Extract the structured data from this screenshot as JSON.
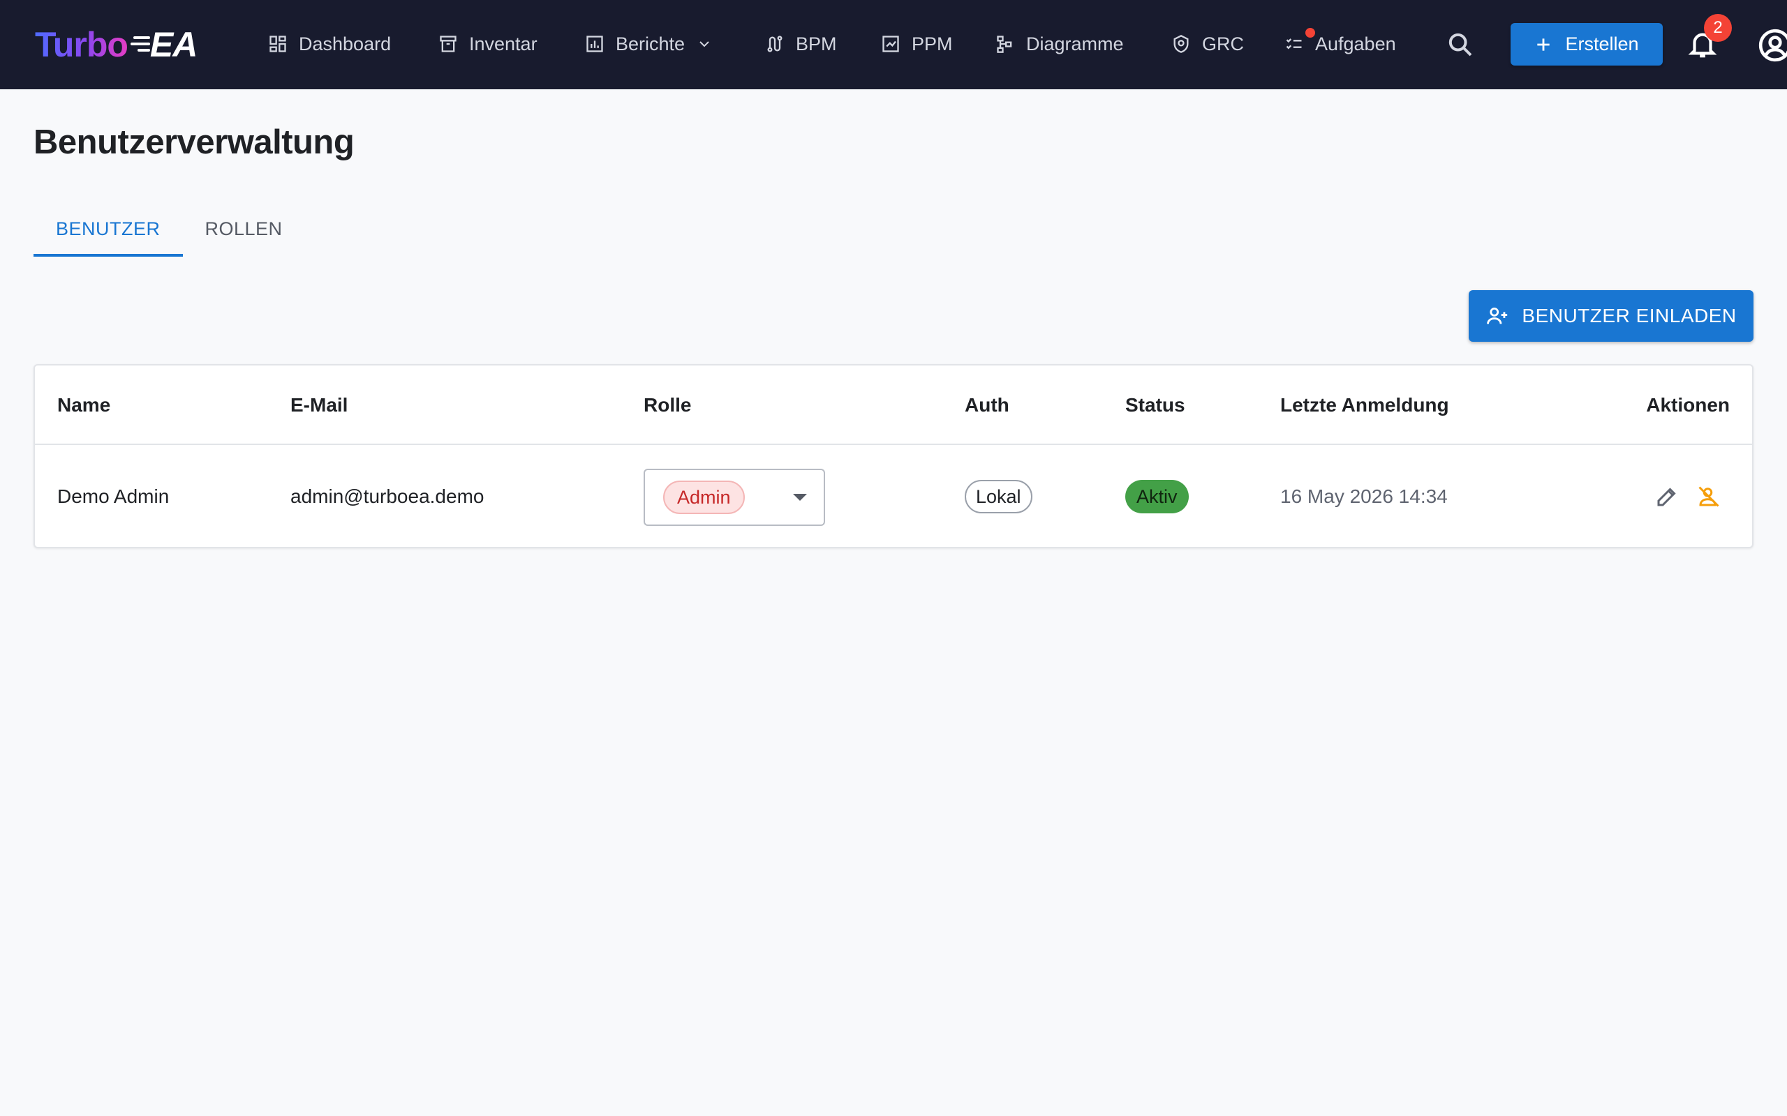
{
  "app": {
    "logo_part1": "Turbo",
    "logo_part2": "EA"
  },
  "nav": {
    "items": [
      {
        "label": "Dashboard",
        "icon": "dashboard-icon"
      },
      {
        "label": "Inventar",
        "icon": "archive-icon"
      },
      {
        "label": "Berichte",
        "icon": "bar-chart-icon"
      },
      {
        "label": "BPM",
        "icon": "route-icon"
      },
      {
        "label": "PPM",
        "icon": "project-icon"
      },
      {
        "label": "Diagramme",
        "icon": "diagram-icon"
      },
      {
        "label": "GRC",
        "icon": "shield-icon"
      },
      {
        "label": "Aufgaben",
        "icon": "checklist-icon"
      }
    ],
    "create_label": "Erstellen",
    "notification_count": "2"
  },
  "page": {
    "title": "Benutzerverwaltung",
    "tabs": [
      {
        "label": "BENUTZER",
        "active": true
      },
      {
        "label": "ROLLEN",
        "active": false
      }
    ],
    "invite_label": "BENUTZER EINLADEN"
  },
  "table": {
    "headers": {
      "name": "Name",
      "email": "E-Mail",
      "role": "Rolle",
      "auth": "Auth",
      "status": "Status",
      "last_login": "Letzte Anmeldung",
      "actions": "Aktionen"
    },
    "rows": [
      {
        "name": "Demo Admin",
        "email": "admin@turboea.demo",
        "role": "Admin",
        "auth": "Lokal",
        "status": "Aktiv",
        "last_login": "16 May 2026 14:34"
      }
    ]
  },
  "colors": {
    "topbar": "#181b2e",
    "accent": "#1976d2",
    "status_active": "#43a047",
    "badge": "#f44336",
    "deactivate_icon": "#f59e0b"
  }
}
